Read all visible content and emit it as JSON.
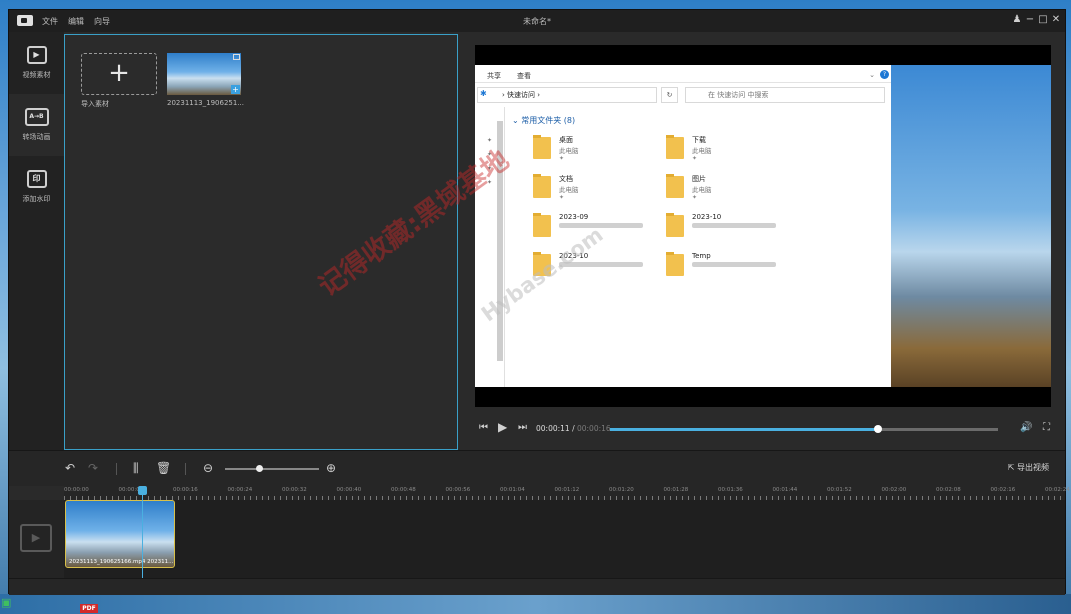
{
  "titlebar": {
    "menus": [
      "文件",
      "编辑",
      "向导"
    ],
    "title": "未命名*"
  },
  "sidebar": {
    "items": [
      {
        "label": "视频素材",
        "icon": "video-material-icon",
        "glyph": "▶"
      },
      {
        "label": "转场动画",
        "icon": "transition-icon",
        "glyph": "A→B"
      },
      {
        "label": "添加水印",
        "icon": "watermark-icon",
        "glyph": "印"
      }
    ]
  },
  "media": {
    "import_label": "导入素材",
    "clip_label": "20231113_1906251..."
  },
  "explorer": {
    "tabs": [
      "共享",
      "查看"
    ],
    "address": "快速访问",
    "search_placeholder": "在 快速访问 中搜索",
    "group_title": "常用文件夹 (8)",
    "folders": [
      {
        "name": "桌面",
        "sub": "此电脑"
      },
      {
        "name": "下载",
        "sub": "此电脑"
      },
      {
        "name": "文档",
        "sub": "此电脑"
      },
      {
        "name": "图片",
        "sub": "此电脑"
      },
      {
        "name": "2023-09",
        "sub": ""
      },
      {
        "name": "2023-10",
        "sub": ""
      },
      {
        "name": "2023-10",
        "sub": ""
      },
      {
        "name": "Temp",
        "sub": ""
      }
    ]
  },
  "watermark": {
    "text": "记得收藏:黑域基地",
    "url": "Hybase.com"
  },
  "player": {
    "current_time": "00:00:11",
    "total_time": "00:00:16",
    "progress": 0.69
  },
  "toolbar": {
    "export_label": "导出视频",
    "zoom_level": 0.36
  },
  "timeline": {
    "ticks": [
      "00:00:00",
      "00:00:08",
      "00:00:16",
      "00:00:24",
      "00:00:32",
      "00:00:40",
      "00:00:48",
      "00:00:56",
      "00:01:04",
      "00:01:12",
      "00:01:20",
      "00:01:28",
      "00:01:36",
      "00:01:44",
      "00:01:52",
      "00:02:00",
      "00:02:08",
      "00:02:16",
      "00:02:24"
    ],
    "clip_label": "20231113_190625166.mp4",
    "clip_label_2": "202311..."
  },
  "desktop": {
    "pdf_label": "PDF"
  }
}
